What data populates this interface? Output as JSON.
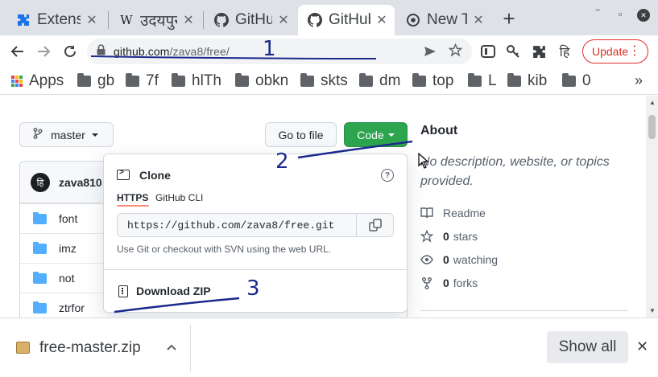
{
  "browser": {
    "tabs": [
      {
        "title": "Extens",
        "icon": "puzzle-icon",
        "active": false
      },
      {
        "title": "उदयपुर",
        "icon": "wikipedia-icon",
        "active": false
      },
      {
        "title": "GitHub",
        "icon": "github-icon",
        "active": false
      },
      {
        "title": "GitHub",
        "icon": "github-icon",
        "active": true
      },
      {
        "title": "New Tab",
        "icon": "chrome-icon",
        "active": false
      }
    ],
    "tab_close_glyph": "✕",
    "new_tab_glyph": "+",
    "window_controls": {
      "minimize": "‾",
      "maximize": "▫",
      "close": "✕"
    },
    "url": {
      "host": "github.com",
      "path": "/zava8/free/"
    },
    "update_label": "Update",
    "extension_hindi_label": "हि",
    "accent_color": "#d93025",
    "bookmarks": [
      {
        "label": "Apps",
        "type": "apps"
      },
      {
        "label": "gb",
        "type": "folder"
      },
      {
        "label": "7f",
        "type": "folder"
      },
      {
        "label": "hlTh",
        "type": "folder"
      },
      {
        "label": "obkn",
        "type": "folder"
      },
      {
        "label": "skts",
        "type": "folder"
      },
      {
        "label": "dm",
        "type": "folder"
      },
      {
        "label": "top",
        "type": "folder"
      },
      {
        "label": "L",
        "type": "folder"
      },
      {
        "label": "kib",
        "type": "folder"
      },
      {
        "label": "0",
        "type": "folder"
      }
    ],
    "bookmarks_overflow": "»"
  },
  "repo": {
    "branch": "master",
    "goto_file_label": "Go to file",
    "code_label": "Code",
    "owner": "zava810",
    "avatar_text": "हि",
    "files": [
      "font",
      "imz",
      "not",
      "ztrfor"
    ],
    "brand_green": "#2da44e"
  },
  "clone": {
    "title": "Clone",
    "help_glyph": "?",
    "tabs": [
      "HTTPS",
      "GitHub CLI"
    ],
    "url": "https://github.com/zava8/free.git",
    "hint": "Use Git or checkout with SVN using the web URL.",
    "download_zip": "Download ZIP"
  },
  "about": {
    "title": "About",
    "description": "No description, website, or topics provided.",
    "readme": "Readme",
    "stars_count": "0",
    "stars_label": "stars",
    "watching_count": "0",
    "watching_label": "watching",
    "forks_count": "0",
    "forks_label": "forks"
  },
  "annotations": [
    "1",
    "2",
    "3"
  ],
  "download_bar": {
    "filename": "free-master.zip",
    "show_all": "Show all",
    "close_glyph": "✕"
  }
}
